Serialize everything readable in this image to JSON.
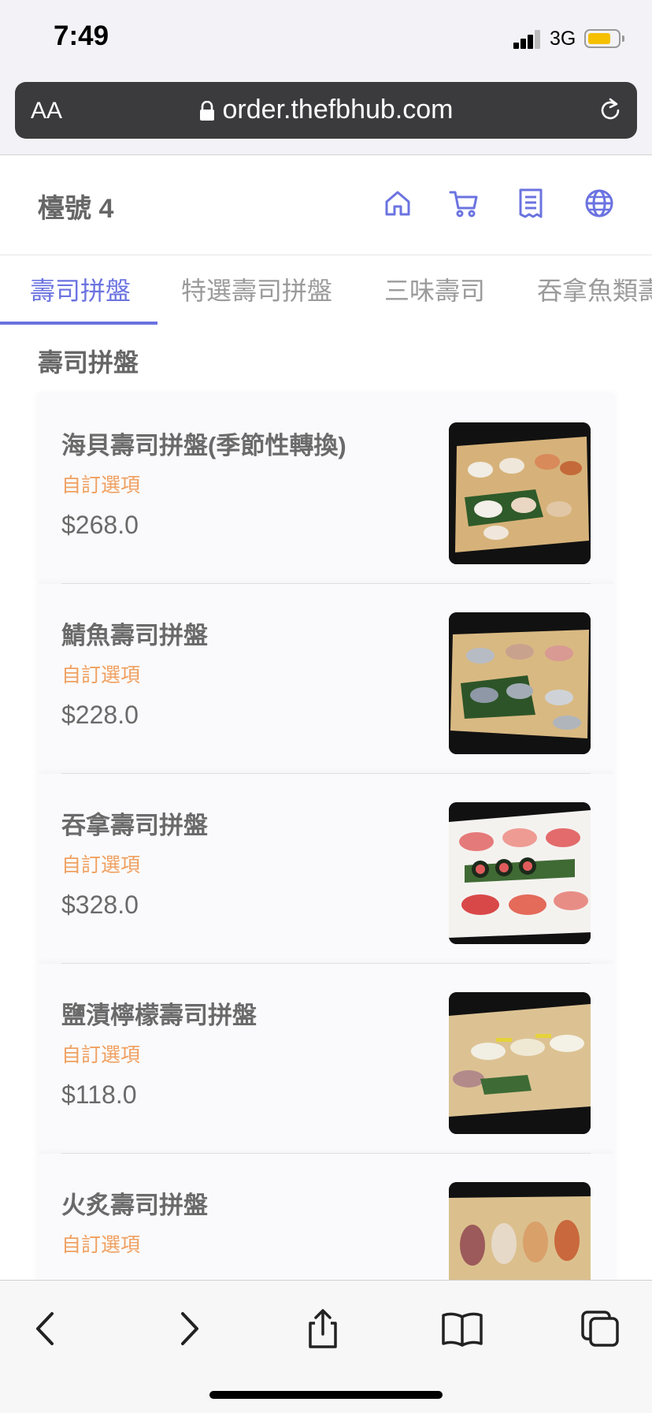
{
  "status_bar": {
    "time": "7:49",
    "network": "3G"
  },
  "browser": {
    "aa_label": "AA",
    "url": "order.thefbhub.com"
  },
  "header": {
    "table_number": "檯號 4"
  },
  "tabs": [
    {
      "label": "壽司拼盤"
    },
    {
      "label": "特選壽司拼盤"
    },
    {
      "label": "三味壽司"
    },
    {
      "label": "吞拿魚類壽"
    }
  ],
  "section": {
    "title": "壽司拼盤"
  },
  "items": [
    {
      "name": "海貝壽司拼盤(季節性轉換)",
      "option": "自訂選項",
      "price": "$268.0"
    },
    {
      "name": "鯖魚壽司拼盤",
      "option": "自訂選項",
      "price": "$228.0"
    },
    {
      "name": "吞拿壽司拼盤",
      "option": "自訂選項",
      "price": "$328.0"
    },
    {
      "name": "鹽漬檸檬壽司拼盤",
      "option": "自訂選項",
      "price": "$118.0"
    },
    {
      "name": "火炙壽司拼盤",
      "option": "自訂選項",
      "price": ""
    }
  ],
  "colors": {
    "accent": "#6b73e0",
    "option_text": "#f0a060"
  }
}
